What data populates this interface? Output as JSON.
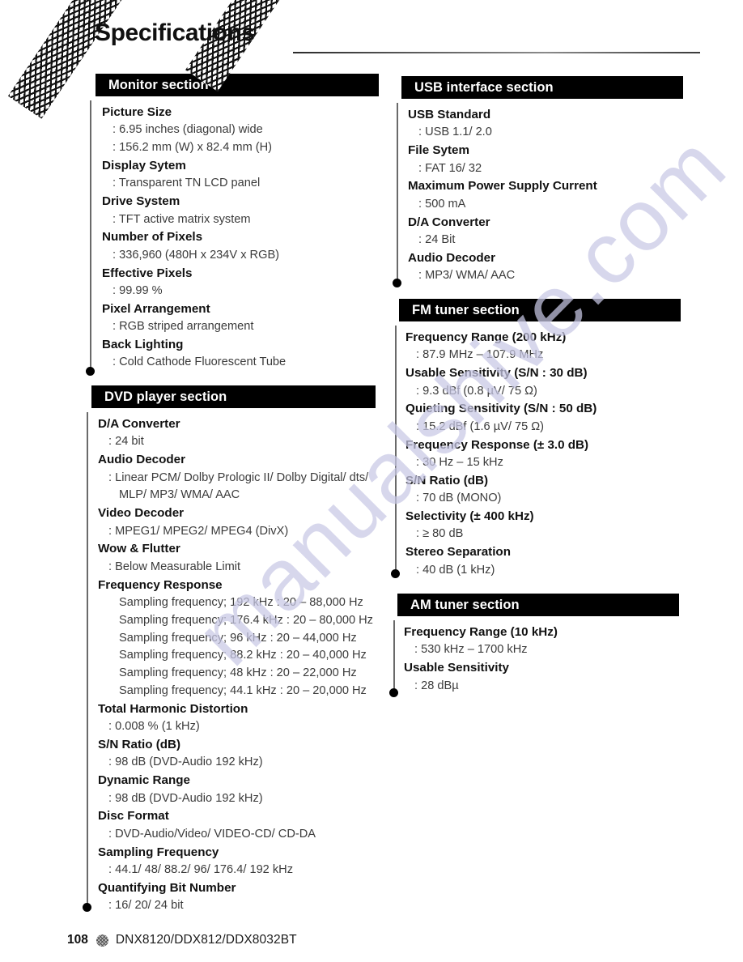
{
  "page": {
    "title": "Specifications",
    "watermark": "manualshive.com"
  },
  "footer": {
    "page_number": "108",
    "emblem_icon": "globe-emblem-icon",
    "models": "DNX8120/DDX812/DDX8032BT"
  },
  "sections": {
    "monitor": {
      "heading": "Monitor section",
      "items": [
        {
          "term": "Picture Size",
          "defs": [
            ": 6.95 inches (diagonal) wide",
            ": 156.2 mm (W) x 82.4 mm (H)"
          ]
        },
        {
          "term": "Display Sytem",
          "defs": [
            ": Transparent TN LCD panel"
          ]
        },
        {
          "term": "Drive System",
          "defs": [
            ": TFT active matrix system"
          ]
        },
        {
          "term": "Number of Pixels",
          "defs": [
            ": 336,960 (480H x 234V x RGB)"
          ]
        },
        {
          "term": "Effective Pixels",
          "defs": [
            ": 99.99 %"
          ]
        },
        {
          "term": "Pixel Arrangement",
          "defs": [
            ": RGB striped arrangement"
          ]
        },
        {
          "term": "Back Lighting",
          "defs": [
            ": Cold Cathode Fluorescent Tube"
          ]
        }
      ]
    },
    "dvd": {
      "heading": "DVD player section",
      "items": [
        {
          "term": "D/A Converter",
          "defs": [
            ": 24 bit"
          ]
        },
        {
          "term": "Audio Decoder",
          "defs": [
            ": Linear PCM/ Dolby Prologic II/ Dolby Digital/ dts/",
            "MLP/ MP3/ WMA/ AAC"
          ]
        },
        {
          "term": "Video Decoder",
          "defs": [
            ": MPEG1/ MPEG2/ MPEG4 (DivX)"
          ]
        },
        {
          "term": "Wow & Flutter",
          "defs": [
            ": Below Measurable Limit"
          ]
        },
        {
          "term": "Frequency Response",
          "defs": [
            "Sampling frequency; 192 kHz : 20 – 88,000 Hz",
            "Sampling frequency; 176.4 kHz : 20 – 80,000 Hz",
            "Sampling frequency; 96 kHz : 20 – 44,000 Hz",
            "Sampling frequency; 88.2 kHz : 20 – 40,000 Hz",
            "Sampling frequency; 48 kHz : 20 – 22,000 Hz",
            "Sampling frequency; 44.1 kHz : 20 – 20,000 Hz"
          ]
        },
        {
          "term": "Total Harmonic Distortion",
          "defs": [
            ": 0.008 % (1 kHz)"
          ]
        },
        {
          "term": "S/N Ratio (dB)",
          "defs": [
            ": 98 dB (DVD-Audio 192 kHz)"
          ]
        },
        {
          "term": "Dynamic Range",
          "defs": [
            ": 98 dB (DVD-Audio 192 kHz)"
          ]
        },
        {
          "term": "Disc Format",
          "defs": [
            ": DVD-Audio/Video/ VIDEO-CD/ CD-DA"
          ]
        },
        {
          "term": "Sampling Frequency",
          "defs": [
            ": 44.1/ 48/ 88.2/ 96/ 176.4/ 192 kHz"
          ]
        },
        {
          "term": "Quantifying Bit Number",
          "defs": [
            ": 16/ 20/ 24 bit"
          ]
        }
      ]
    },
    "usb": {
      "heading": "USB interface section",
      "items": [
        {
          "term": "USB Standard",
          "defs": [
            ": USB 1.1/ 2.0"
          ]
        },
        {
          "term": "File Sytem",
          "defs": [
            ": FAT 16/ 32"
          ]
        },
        {
          "term": "Maximum Power Supply Current",
          "defs": [
            ": 500 mA"
          ]
        },
        {
          "term": "D/A Converter",
          "defs": [
            ": 24 Bit"
          ]
        },
        {
          "term": "Audio Decoder",
          "defs": [
            ": MP3/ WMA/ AAC"
          ]
        }
      ]
    },
    "fm": {
      "heading": "FM tuner section",
      "items": [
        {
          "term": "Frequency Range (200 kHz)",
          "defs": [
            ": 87.9 MHz – 107.9 MHz"
          ]
        },
        {
          "term": "Usable Sensitivity (S/N : 30 dB)",
          "defs": [
            ": 9.3 dBf (0.8 µV/ 75 Ω)"
          ]
        },
        {
          "term": "Quieting Sensitivity (S/N : 50 dB)",
          "defs": [
            ": 15.2 dBf (1.6 µV/ 75 Ω)"
          ]
        },
        {
          "term": "Frequency Response (± 3.0 dB)",
          "defs": [
            ": 30 Hz – 15 kHz"
          ]
        },
        {
          "term": "S/N Ratio (dB)",
          "defs": [
            ": 70 dB (MONO)"
          ]
        },
        {
          "term": "Selectivity (± 400 kHz)",
          "defs": [
            ": ≥ 80 dB"
          ]
        },
        {
          "term": "Stereo Separation",
          "defs": [
            ": 40 dB (1 kHz)"
          ]
        }
      ]
    },
    "am": {
      "heading": "AM tuner section",
      "items": [
        {
          "term": "Frequency Range (10 kHz)",
          "defs": [
            ": 530 kHz – 1700 kHz"
          ]
        },
        {
          "term": "Usable Sensitivity",
          "defs": [
            ": 28 dBµ"
          ]
        }
      ]
    }
  }
}
